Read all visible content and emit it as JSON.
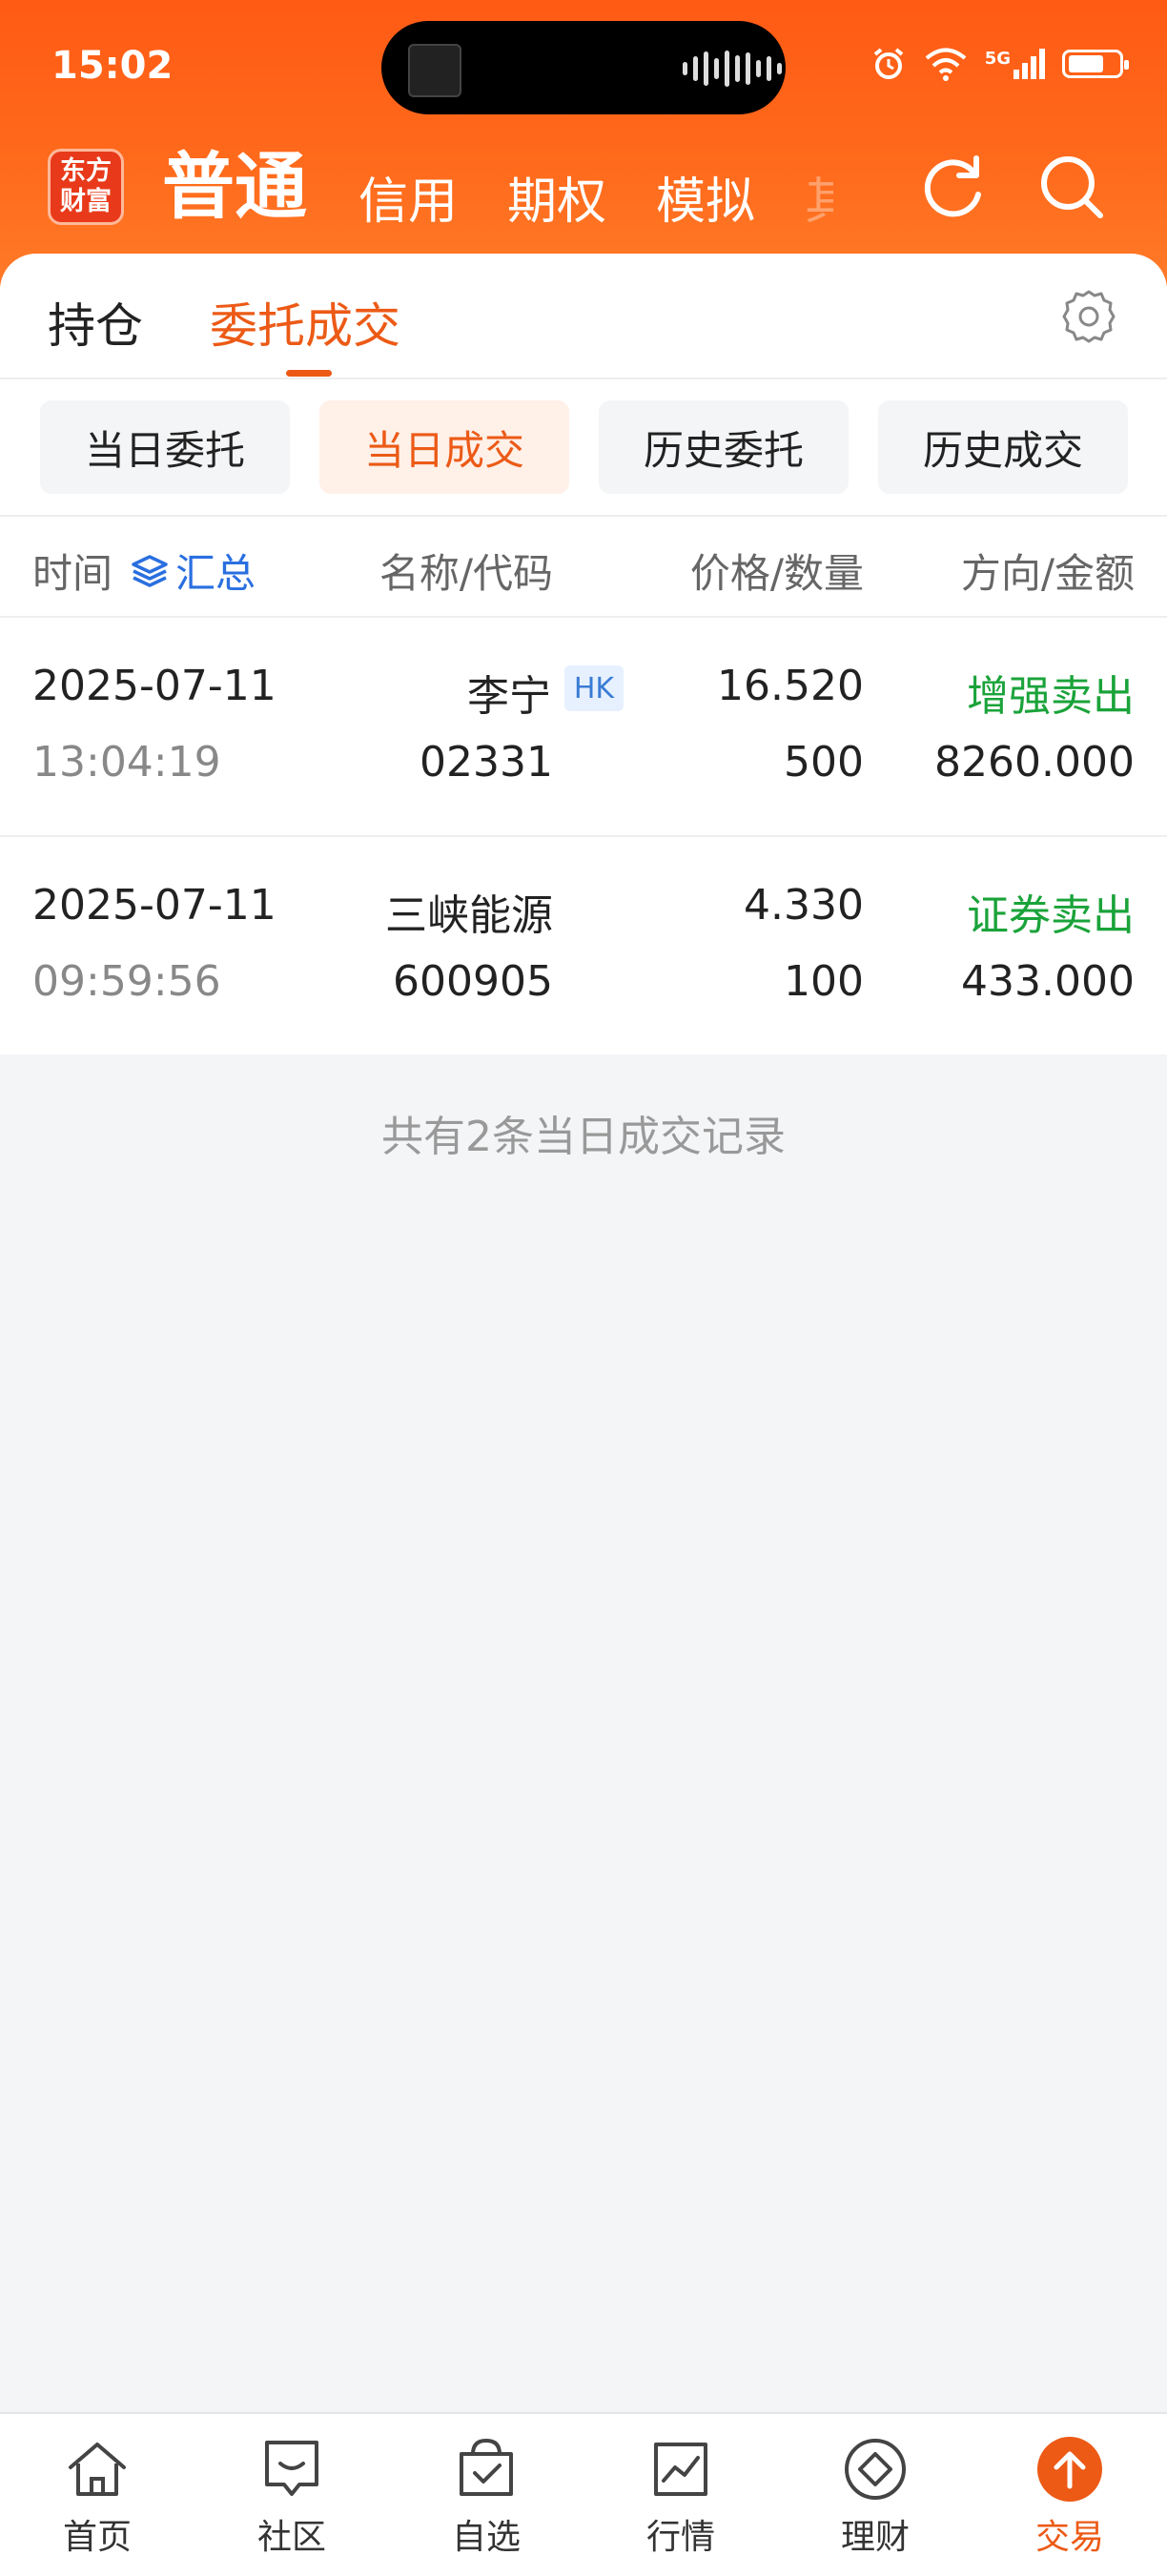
{
  "status_bar": {
    "time": "15:02",
    "network": "5G"
  },
  "header": {
    "logo_line1": "东方",
    "logo_line2": "财富",
    "tabs": [
      {
        "label": "普通",
        "active": true
      },
      {
        "label": "信用"
      },
      {
        "label": "期权"
      },
      {
        "label": "模拟"
      },
      {
        "label": "其"
      }
    ],
    "refresh_icon": "refresh-icon",
    "search_icon": "search-icon"
  },
  "subtabs": {
    "holdings": "持仓",
    "orders": "委托成交",
    "settings_icon": "gear-icon"
  },
  "filters": [
    {
      "label": "当日委托"
    },
    {
      "label": "当日成交",
      "active": true
    },
    {
      "label": "历史委托"
    },
    {
      "label": "历史成交"
    }
  ],
  "columns": {
    "time": "时间",
    "summary": "汇总",
    "name_code": "名称/代码",
    "price_qty": "价格/数量",
    "direction_amount": "方向/金额"
  },
  "trades": [
    {
      "date": "2025-07-11",
      "time": "13:04:19",
      "name": "李宁",
      "badge": "HK",
      "code": "02331",
      "price": "16.520",
      "quantity": "500",
      "direction": "增强卖出",
      "amount": "8260.000"
    },
    {
      "date": "2025-07-11",
      "time": "09:59:56",
      "name": "三峡能源",
      "code": "600905",
      "price": "4.330",
      "quantity": "100",
      "direction": "证券卖出",
      "amount": "433.000"
    }
  ],
  "footer_note": "共有2条当日成交记录",
  "bottom_nav": [
    {
      "label": "首页",
      "icon": "home-icon"
    },
    {
      "label": "社区",
      "icon": "community-icon"
    },
    {
      "label": "自选",
      "icon": "watchlist-icon"
    },
    {
      "label": "行情",
      "icon": "market-icon"
    },
    {
      "label": "理财",
      "icon": "wealth-icon"
    },
    {
      "label": "交易",
      "icon": "trade-icon",
      "active": true
    }
  ],
  "colors": {
    "brand": "#ff5a14",
    "accent": "#ec5a16",
    "sell": "#1aa33a",
    "summary_link": "#2a6fe0"
  }
}
